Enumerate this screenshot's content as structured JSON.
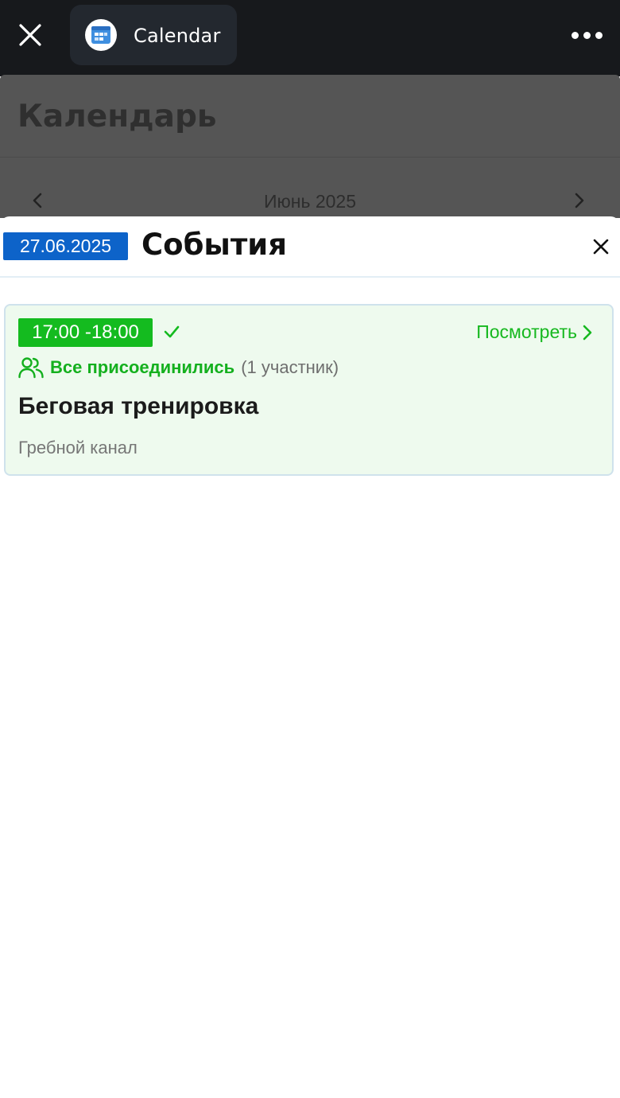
{
  "topbar": {
    "close_icon": "close-icon",
    "app_name": "Calendar",
    "app_icon": "calendar-app-icon",
    "more_icon": "more-dots-icon"
  },
  "background_page": {
    "title": "Календарь",
    "month_label": "Июнь 2025",
    "prev_icon": "chevron-left-icon",
    "next_icon": "chevron-right-icon"
  },
  "sheet": {
    "date": "27.06.2025",
    "title": "События",
    "close_icon": "close-icon",
    "events": [
      {
        "time": "17:00 -18:00",
        "status_icon": "checkmark-icon",
        "view_label": "Посмотреть",
        "joined_label": "Все присоединились",
        "participants_label": "(1 участник)",
        "title": "Беговая тренировка",
        "location": "Гребной канал"
      }
    ]
  },
  "colors": {
    "topbar_bg": "#17191c",
    "app_chip_bg": "#23282f",
    "date_badge": "#0d63c9",
    "accent_green": "#14bb1f",
    "card_bg": "#eefaee",
    "card_border": "#cfe2ec"
  }
}
